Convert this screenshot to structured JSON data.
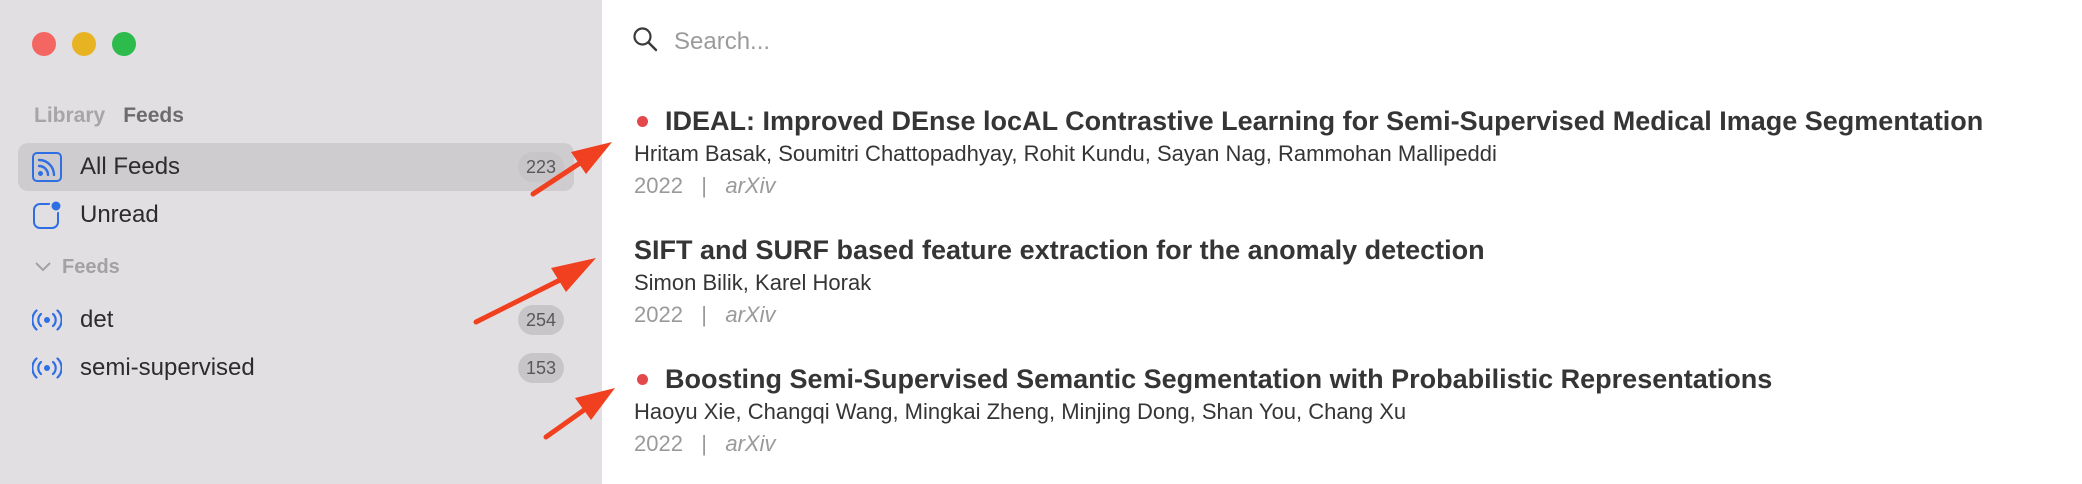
{
  "window": {
    "controls": [
      "close",
      "minimize",
      "maximize"
    ],
    "colors": {
      "close": "#f46661",
      "minimize": "#e8b323",
      "maximize": "#2dbb4c"
    }
  },
  "sidebar": {
    "segments": {
      "library": "Library",
      "feeds": "Feeds"
    },
    "all_feeds": {
      "label": "All Feeds",
      "count": "223",
      "icon": "rss-icon"
    },
    "unread": {
      "label": "Unread",
      "icon": "unread-badge-icon"
    },
    "feeds_group": {
      "label": "Feeds",
      "icon": "chevron-down-icon"
    },
    "feeds": [
      {
        "label": "det",
        "count": "254",
        "icon": "broadcast-icon"
      },
      {
        "label": "semi-supervised",
        "count": "153",
        "icon": "broadcast-icon"
      }
    ]
  },
  "search": {
    "placeholder": "Search...",
    "icon": "search-icon"
  },
  "papers": [
    {
      "unread": true,
      "title": "IDEAL: Improved DEnse locAL Contrastive Learning for Semi-Supervised Medical Image Segmentation",
      "authors": "Hritam Basak, Soumitri Chattopadhyay, Rohit Kundu, Sayan Nag, Rammohan Mallipeddi",
      "year": "2022",
      "separator": "|",
      "venue": "arXiv"
    },
    {
      "unread": false,
      "title": "SIFT and SURF based feature extraction for the anomaly detection",
      "authors": "Simon Bilik, Karel Horak",
      "year": "2022",
      "separator": "|",
      "venue": "arXiv"
    },
    {
      "unread": true,
      "title": "Boosting Semi-Supervised Semantic Segmentation with Probabilistic Representations",
      "authors": "Haoyu Xie, Changqi Wang, Mingkai Zheng, Minjing Dong, Shan You, Chang Xu",
      "year": "2022",
      "separator": "|",
      "venue": "arXiv"
    }
  ],
  "colors": {
    "accent": "#2f6fe4",
    "unread_dot": "#e5484b",
    "annotation_arrow": "#f0401f"
  }
}
